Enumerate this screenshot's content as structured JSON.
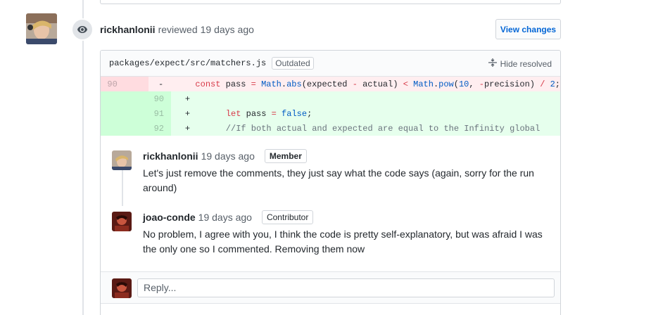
{
  "review": {
    "author": "rickhanlonii",
    "action": "reviewed",
    "time": "19 days ago",
    "view_changes_label": "View changes"
  },
  "file": {
    "path": "packages/expect/src/matchers.js",
    "badge": "Outdated",
    "hide_resolved_label": "Hide resolved"
  },
  "diff": {
    "rows": [
      {
        "type": "del",
        "old": "90",
        "new": "",
        "marker": "-",
        "code": "    const pass = Math.abs(expected - actual) < Math.pow(10, -precision) / 2;"
      },
      {
        "type": "add",
        "old": "",
        "new": "90",
        "marker": "+",
        "code": ""
      },
      {
        "type": "add",
        "old": "",
        "new": "91",
        "marker": "+",
        "code": "    let pass = false;"
      },
      {
        "type": "add",
        "old": "",
        "new": "92",
        "marker": "+",
        "code": "    //If both actual and expected are equal to the Infinity global"
      }
    ]
  },
  "comments": [
    {
      "author": "rickhanlonii",
      "time": "19 days ago",
      "role": "Member",
      "body": "Let's just remove the comments, they just say what the code says (again, sorry for the run around)"
    },
    {
      "author": "joao-conde",
      "time": "19 days ago",
      "role": "Contributor",
      "body": "No problem, I agree with you, I think the code is pretty self-explanatory, but was afraid I was the only one so I commented. Removing them now"
    }
  ],
  "reply": {
    "placeholder": "Reply..."
  },
  "colors": {
    "link": "#0366d6",
    "deletion_bg": "#ffeef0",
    "addition_bg": "#e6ffed"
  }
}
